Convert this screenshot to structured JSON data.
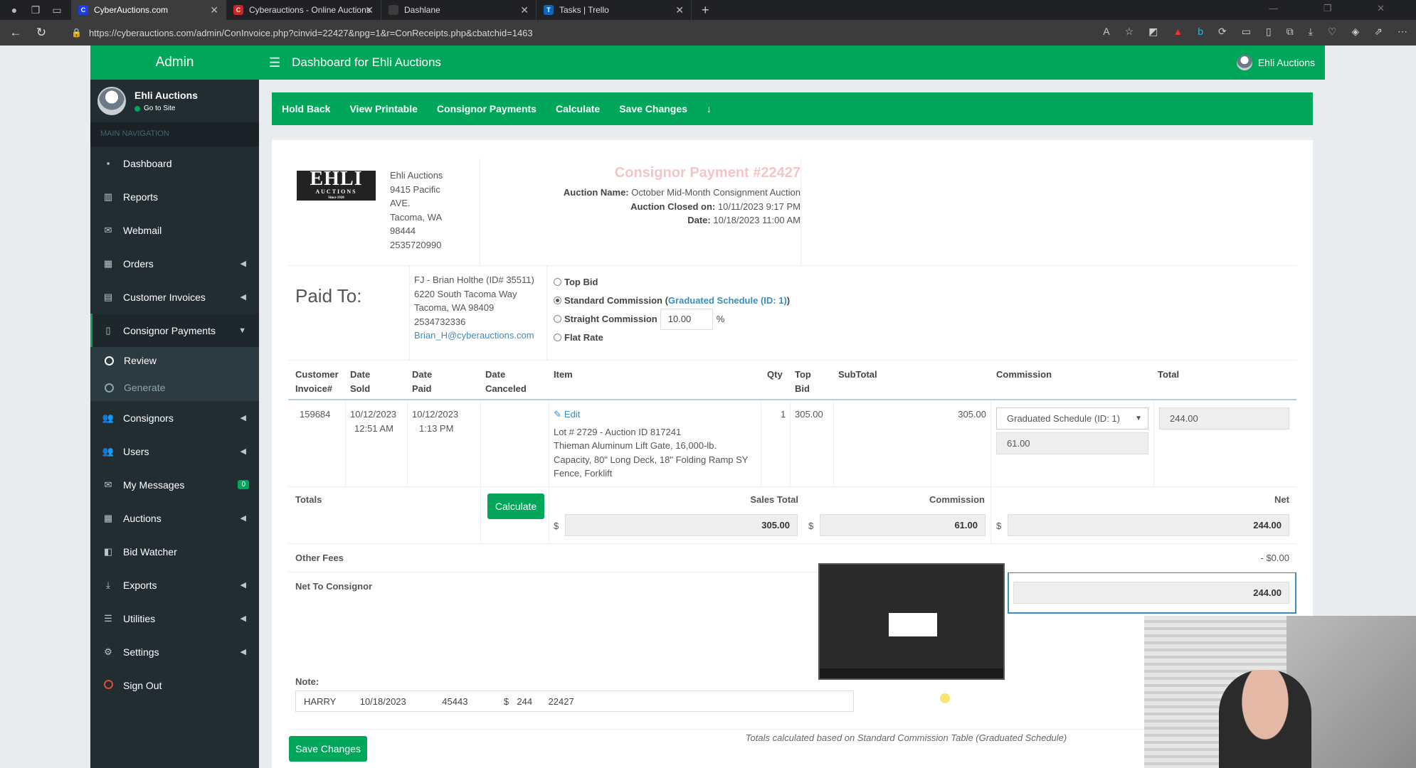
{
  "browser": {
    "tabs": [
      {
        "title": "CyberAuctions.com",
        "fav": "C",
        "fav_color": "#1a3ee8"
      },
      {
        "title": "Cyberauctions - Online Auctions",
        "fav": "C",
        "fav_color": "#d32222"
      },
      {
        "title": "Dashlane",
        "fav": "",
        "fav_color": "#3c3c3c"
      },
      {
        "title": "Tasks | Trello",
        "fav": "T",
        "fav_color": "#0b66c2"
      }
    ],
    "url": "https://cyberauctions.com/admin/ConInvoice.php?cinvid=22427&npg=1&r=ConReceipts.php&cbatchid=1463"
  },
  "sidebar": {
    "brand": "Admin",
    "user_name": "Ehli Auctions",
    "user_status": "Go to Site",
    "nav_header": "MAIN NAVIGATION",
    "items": [
      {
        "label": "Dashboard",
        "icon": "dashboard-icon",
        "glyph": "▪"
      },
      {
        "label": "Reports",
        "icon": "chart-icon",
        "glyph": "▥"
      },
      {
        "label": "Webmail",
        "icon": "envelope-icon",
        "glyph": "✉"
      },
      {
        "label": "Orders",
        "icon": "grid-icon",
        "glyph": "▦"
      },
      {
        "label": "Customer Invoices",
        "icon": "invoice-icon",
        "glyph": "▤"
      },
      {
        "label": "Consignor Payments",
        "icon": "file-icon",
        "glyph": "▯"
      },
      {
        "label": "Consignors",
        "icon": "users-icon",
        "glyph": "👥"
      },
      {
        "label": "Users",
        "icon": "users-icon",
        "glyph": "👥"
      },
      {
        "label": "My Messages",
        "icon": "envelope-icon",
        "glyph": "✉",
        "badge": "0"
      },
      {
        "label": "Auctions",
        "icon": "calendar-icon",
        "glyph": "▦"
      },
      {
        "label": "Bid Watcher",
        "icon": "eye-icon",
        "glyph": "◧"
      },
      {
        "label": "Exports",
        "icon": "download-icon",
        "glyph": "⤓"
      },
      {
        "label": "Utilities",
        "icon": "list-icon",
        "glyph": "☰"
      },
      {
        "label": "Settings",
        "icon": "gear-icon",
        "glyph": "⚙"
      },
      {
        "label": "Sign Out",
        "icon": "circle-icon",
        "glyph": ""
      }
    ],
    "sub_items": [
      "Review",
      "Generate"
    ]
  },
  "topbar": {
    "title": "Dashboard for Ehli Auctions",
    "user": "Ehli Auctions"
  },
  "actions": [
    "Hold Back",
    "View Printable",
    "Consignor Payments",
    "Calculate",
    "Save Changes",
    "↓"
  ],
  "company": {
    "logo_text": "EHLI",
    "logo_sub": "AUCTIONS",
    "logo_since": "Since 1920",
    "address": [
      "Ehli Auctions",
      "9415 Pacific",
      "AVE.",
      "Tacoma, WA",
      "98444",
      "2535720990"
    ]
  },
  "payment": {
    "title": "Consignor Payment #22427",
    "auction_name_label": "Auction Name:",
    "auction_name": "October Mid-Month Consignment Auction",
    "closed_label": "Auction Closed on:",
    "closed": "10/11/2023 9:17 PM",
    "date_label": "Date:",
    "date": "10/18/2023 11:00 AM"
  },
  "paid_to": {
    "label": "Paid To:",
    "lines": [
      "FJ - Brian Holthe (ID# 35511)",
      "6220 South Tacoma Way",
      "Tacoma, WA 98409",
      "2534732336"
    ],
    "email": "Brian_H@cyberauctions.com"
  },
  "commission_options": {
    "top_bid": "Top Bid",
    "standard": "Standard Commission",
    "standard_link": "Graduated Schedule (ID: 1)",
    "straight": "Straight Commission",
    "straight_value": "10.00",
    "straight_unit": "%",
    "flat": "Flat Rate",
    "selected": "standard"
  },
  "table": {
    "headers": {
      "customer_invoice": [
        "Customer",
        "Invoice#"
      ],
      "date_sold": [
        "Date",
        "Sold"
      ],
      "date_paid": [
        "Date",
        "Paid"
      ],
      "date_canceled": [
        "Date",
        "Canceled"
      ],
      "item": "Item",
      "qty": "Qty",
      "top_bid": [
        "Top",
        "Bid"
      ],
      "subtotal": "SubTotal",
      "commission": "Commission",
      "total": "Total"
    },
    "row": {
      "invoice": "159684",
      "date_sold": [
        "10/12/2023",
        "12:51 AM"
      ],
      "date_paid": [
        "10/12/2023",
        "1:13 PM"
      ],
      "edit": "Edit",
      "item_lines": [
        "Lot # 2729 - Auction ID 817241",
        "Thieman Aluminum Lift Gate, 16,000-lb.",
        "Capacity, 80\" Long Deck, 18\" Folding Ramp SY",
        "Fence, Forklift"
      ],
      "qty": "1",
      "top_bid": "305.00",
      "subtotal": "305.00",
      "commission_schedule": "Graduated Schedule (ID: 1)",
      "commission_amount": "61.00",
      "total": "244.00"
    }
  },
  "totals": {
    "label": "Totals",
    "calculate": "Calculate",
    "sales_total_label": "Sales Total",
    "sales_total": "305.00",
    "commission_label": "Commission",
    "commission": "61.00",
    "net_label": "Net",
    "net": "244.00",
    "currency": "$",
    "other_fees_label": "Other Fees",
    "other_fees": "- $0.00",
    "net_to_consignor_label": "Net To Consignor",
    "net_to_consignor": "244.00"
  },
  "note": {
    "label": "Note:",
    "value": "HARRY      10/18/2023         45443         $  244    22427"
  },
  "footer_note": "Totals calculated based on Standard Commission Table (Graduated Schedule)",
  "save_changes": "Save Changes"
}
